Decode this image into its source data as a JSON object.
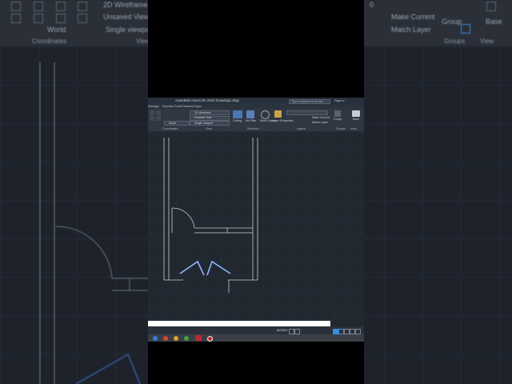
{
  "background": {
    "ribbon_items": [
      "2D Wireframe",
      "Unsaved View",
      "Single viewport",
      "World",
      "Make Current",
      "Match Layer",
      "Group",
      "Base"
    ],
    "ribbon_groups": [
      "Coordinates",
      "View",
      "Groups",
      "View"
    ],
    "layer_value": "0"
  },
  "app": {
    "title": "Autodesk AutoCAD 2022   Drawing1.dwg",
    "search_placeholder": "Type a keyword or phrase",
    "user": "Sign In",
    "tabs": [
      "Home",
      "Insert",
      "Annotate",
      "Parametric",
      "View",
      "Manage",
      "Output",
      "Add-ins",
      "Collaborate",
      "Express Tools",
      "Featured Apps"
    ],
    "ribbon": {
      "visual_style": "2D Wireframe",
      "named_view": "Unsaved View",
      "coords": "World",
      "viewport_config": "Single viewport",
      "culling": "Culling",
      "no_filter": "No Filter",
      "move_gizmo": "Move Gizmo",
      "layer_properties": "Layer Properties",
      "make_current": "Make Current",
      "match_layer": "Match Layer",
      "group": "Group",
      "base": "Base",
      "groups": {
        "coordinates": "Coordinates",
        "view": "View",
        "selection": "Selection",
        "layers": "Layers",
        "groups": "Groups",
        "view2": "View"
      }
    },
    "status": {
      "model": "MODEL"
    }
  },
  "colors": {
    "wall": "#c9cfd6",
    "door_highlight": "#8fb6ff",
    "accent": "#3d8bd9"
  }
}
